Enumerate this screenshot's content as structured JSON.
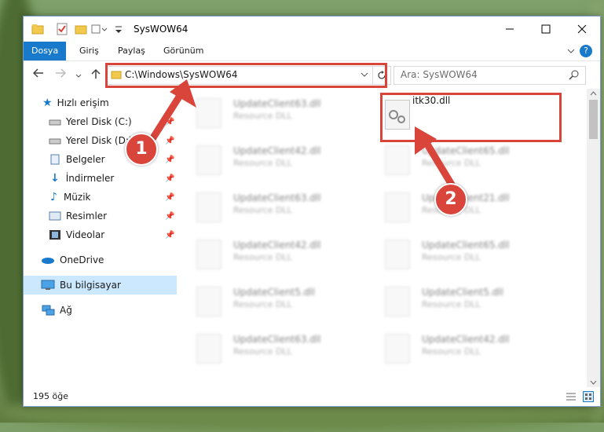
{
  "window": {
    "title": "SysWOW64"
  },
  "ribbon": {
    "tabs": [
      "Dosya",
      "Giriş",
      "Paylaş",
      "Görünüm"
    ]
  },
  "address": {
    "path": "C:\\Windows\\SysWOW64"
  },
  "search": {
    "placeholder": "Ara: SysWOW64"
  },
  "sidebar": {
    "items": [
      {
        "label": "Hızlı erişim",
        "icon": "star-icon"
      },
      {
        "label": "Yerel Disk (C:)",
        "icon": "drive-icon"
      },
      {
        "label": "Yerel Disk (D:)",
        "icon": "drive-icon"
      },
      {
        "label": "Belgeler",
        "icon": "documents-icon"
      },
      {
        "label": "İndirmeler",
        "icon": "download-icon"
      },
      {
        "label": "Müzik",
        "icon": "music-icon"
      },
      {
        "label": "Resimler",
        "icon": "pictures-icon"
      },
      {
        "label": "Videolar",
        "icon": "video-icon"
      },
      {
        "label": "OneDrive",
        "icon": "cloud-icon"
      },
      {
        "label": "Bu bilgisayar",
        "icon": "computer-icon"
      },
      {
        "label": "Ağ",
        "icon": "network-icon"
      }
    ]
  },
  "files": {
    "highlight": {
      "name": "itk30.dll"
    },
    "left": [
      {
        "name": "UpdateClient63.dll",
        "type": "Resource DLL"
      },
      {
        "name": "UpdateClient42.dll",
        "type": "Resource DLL"
      },
      {
        "name": "UpdateClient63.dll",
        "type": "Resource DLL"
      },
      {
        "name": "UpdateClient42.dll",
        "type": "Resource DLL"
      },
      {
        "name": "UpdateClient5.dll",
        "type": "Resource DLL"
      },
      {
        "name": "UpdateClient63.dll",
        "type": "Resource DLL"
      }
    ],
    "right": [
      {
        "name": "UpdateClient65.dll",
        "type": "Resource DLL"
      },
      {
        "name": "UpdateClient21.dll",
        "type": "Resource DLL"
      },
      {
        "name": "UpdateClient65.dll",
        "type": "Resource DLL"
      },
      {
        "name": "UpdateClient5.dll",
        "type": "Resource DLL"
      },
      {
        "name": "UpdateClient42.dll",
        "type": "Resource DLL"
      }
    ]
  },
  "status": {
    "count": "195 öğe"
  },
  "annotations": {
    "badge1": "1",
    "badge2": "2"
  },
  "colors": {
    "accent": "#1979ca",
    "annotation": "#d9443b",
    "selected": "#cce8ff"
  }
}
